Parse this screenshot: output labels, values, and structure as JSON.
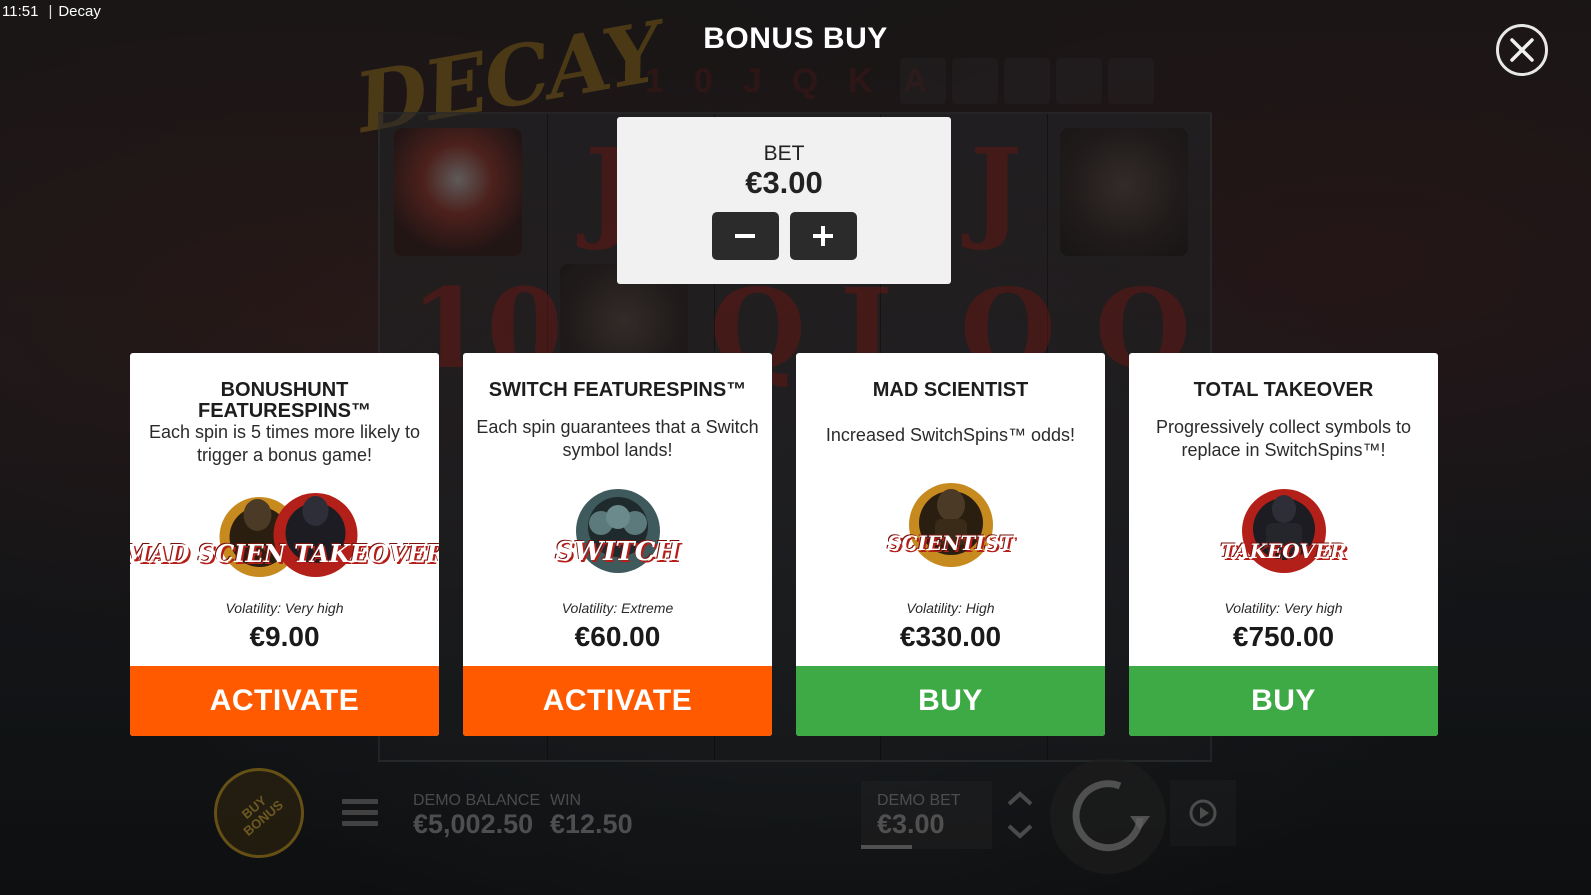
{
  "status_bar": {
    "time": "11:51",
    "app_name": "Decay"
  },
  "background": {
    "logo_text": "DECAY",
    "top_row_letters": "10JQKA",
    "reel_symbols": [
      "J",
      "J",
      "10",
      "Q",
      "J",
      "Q",
      "Q"
    ]
  },
  "header": {
    "title": "BONUS BUY",
    "close_icon": "close-icon"
  },
  "bet_panel": {
    "label": "BET",
    "value": "€3.00",
    "decrease_icon": "minus-icon",
    "increase_icon": "plus-icon"
  },
  "cards": [
    {
      "title": "BONUSHUNT FEATURESPINS™",
      "description": "Each spin is 5 times more likely to trigger a bonus game!",
      "badge_text": "MAD SCIEN TAKEOVER",
      "volatility": "Volatility: Very high",
      "price": "€9.00",
      "action": "ACTIVATE",
      "action_color": "#ff5a00"
    },
    {
      "title": "SWITCH FEATURESPINS™",
      "description": "Each spin guarantees that a Switch symbol lands!",
      "badge_text": "SWITCH",
      "volatility": "Volatility: Extreme",
      "price": "€60.00",
      "action": "ACTIVATE",
      "action_color": "#ff5a00"
    },
    {
      "title": "MAD SCIENTIST",
      "description": "Increased SwitchSpins™ odds!",
      "badge_text": "SCIENTIST",
      "volatility": "Volatility: High",
      "price": "€330.00",
      "action": "BUY",
      "action_color": "#3daa46"
    },
    {
      "title": "TOTAL TAKEOVER",
      "description": "Progressively collect symbols to replace in SwitchSpins™!",
      "badge_text": "TAKEOVER",
      "volatility": "Volatility: Very high",
      "price": "€750.00",
      "action": "BUY",
      "action_color": "#3daa46"
    }
  ],
  "bottom_bar": {
    "buy_bonus_label": "BUY\nBONUS",
    "demo_balance_label": "DEMO BALANCE",
    "demo_balance_value": "€5,002.50",
    "win_label": "WIN",
    "win_value": "€12.50",
    "demo_bet_label": "DEMO BET",
    "demo_bet_value": "€3.00"
  }
}
